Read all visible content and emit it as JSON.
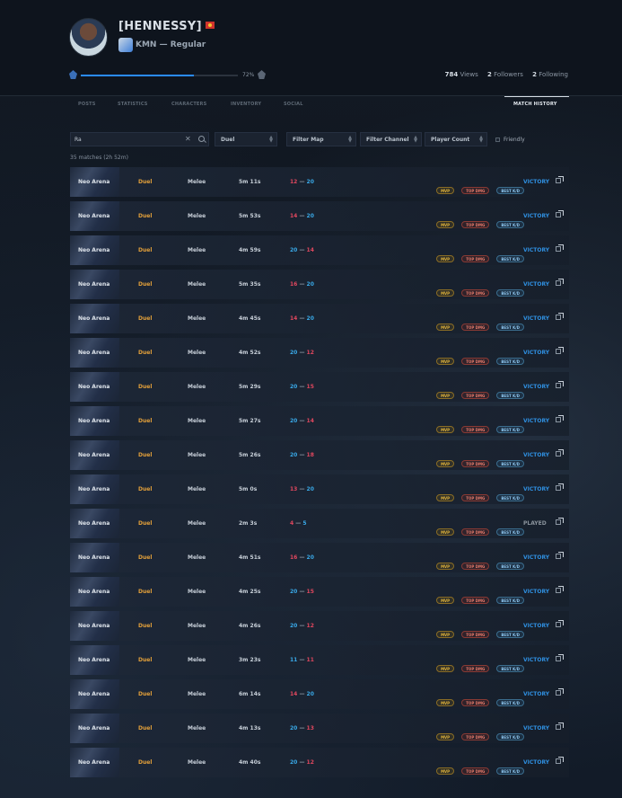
{
  "profile": {
    "username": "[HENNESSY]",
    "rank": "KMN — Regular",
    "xp_percent_label": "72%",
    "xp_fraction": 0.72,
    "views": "784",
    "views_label": "Views",
    "followers": "2",
    "followers_label": "Followers",
    "following": "2",
    "following_label": "Following"
  },
  "tabs": [
    "POSTS",
    "STATISTICS",
    "CHARACTERS",
    "INVENTORY",
    "SOCIAL",
    "MATCH HISTORY"
  ],
  "active_tab": "MATCH HISTORY",
  "filters": {
    "search_value": "Ra",
    "clear_symbol": "✕",
    "mode": "Duel",
    "map": "Filter Map",
    "channel": "Filter Channel",
    "player_count": "Player Count",
    "friendly": "Friendly"
  },
  "summary": "35 matches (2h 52m)",
  "badge_labels": {
    "mvp": "MVP",
    "dmg": "TOP DMG",
    "kd": "BEST K/D"
  },
  "colors": {
    "accent": "#2a8bff",
    "mode": "#e3a03a",
    "red": "#e0475e",
    "blue": "#39a9e8"
  },
  "matches": [
    {
      "map": "Neo Arena",
      "mode": "Duel",
      "type": "Melee",
      "duration": "5m 11s",
      "a": "12",
      "b": "20",
      "win": false,
      "result": "VICTORY"
    },
    {
      "map": "Neo Arena",
      "mode": "Duel",
      "type": "Melee",
      "duration": "5m 53s",
      "a": "14",
      "b": "20",
      "win": false,
      "result": "VICTORY"
    },
    {
      "map": "Neo Arena",
      "mode": "Duel",
      "type": "Melee",
      "duration": "4m 59s",
      "a": "20",
      "b": "14",
      "win": true,
      "result": "VICTORY"
    },
    {
      "map": "Neo Arena",
      "mode": "Duel",
      "type": "Melee",
      "duration": "5m 35s",
      "a": "16",
      "b": "20",
      "win": false,
      "result": "VICTORY"
    },
    {
      "map": "Neo Arena",
      "mode": "Duel",
      "type": "Melee",
      "duration": "4m 45s",
      "a": "14",
      "b": "20",
      "win": false,
      "result": "VICTORY"
    },
    {
      "map": "Neo Arena",
      "mode": "Duel",
      "type": "Melee",
      "duration": "4m 52s",
      "a": "20",
      "b": "12",
      "win": true,
      "result": "VICTORY"
    },
    {
      "map": "Neo Arena",
      "mode": "Duel",
      "type": "Melee",
      "duration": "5m 29s",
      "a": "20",
      "b": "15",
      "win": true,
      "result": "VICTORY"
    },
    {
      "map": "Neo Arena",
      "mode": "Duel",
      "type": "Melee",
      "duration": "5m 27s",
      "a": "20",
      "b": "14",
      "win": true,
      "result": "VICTORY"
    },
    {
      "map": "Neo Arena",
      "mode": "Duel",
      "type": "Melee",
      "duration": "5m 26s",
      "a": "20",
      "b": "18",
      "win": true,
      "result": "VICTORY"
    },
    {
      "map": "Neo Arena",
      "mode": "Duel",
      "type": "Melee",
      "duration": "5m 0s",
      "a": "13",
      "b": "20",
      "win": false,
      "result": "VICTORY"
    },
    {
      "map": "Neo Arena",
      "mode": "Duel",
      "type": "Melee",
      "duration": "2m 3s",
      "a": "4",
      "b": "5",
      "win": false,
      "result": "PLAYED"
    },
    {
      "map": "Neo Arena",
      "mode": "Duel",
      "type": "Melee",
      "duration": "4m 51s",
      "a": "16",
      "b": "20",
      "win": false,
      "result": "VICTORY"
    },
    {
      "map": "Neo Arena",
      "mode": "Duel",
      "type": "Melee",
      "duration": "4m 25s",
      "a": "20",
      "b": "15",
      "win": true,
      "result": "VICTORY"
    },
    {
      "map": "Neo Arena",
      "mode": "Duel",
      "type": "Melee",
      "duration": "4m 26s",
      "a": "20",
      "b": "12",
      "win": true,
      "result": "VICTORY"
    },
    {
      "map": "Neo Arena",
      "mode": "Duel",
      "type": "Melee",
      "duration": "3m 23s",
      "a": "11",
      "b": "11",
      "win": true,
      "result": "VICTORY"
    },
    {
      "map": "Neo Arena",
      "mode": "Duel",
      "type": "Melee",
      "duration": "6m 14s",
      "a": "14",
      "b": "20",
      "win": false,
      "result": "VICTORY"
    },
    {
      "map": "Neo Arena",
      "mode": "Duel",
      "type": "Melee",
      "duration": "4m 13s",
      "a": "20",
      "b": "13",
      "win": true,
      "result": "VICTORY"
    },
    {
      "map": "Neo Arena",
      "mode": "Duel",
      "type": "Melee",
      "duration": "4m 40s",
      "a": "20",
      "b": "12",
      "win": true,
      "result": "VICTORY"
    }
  ]
}
